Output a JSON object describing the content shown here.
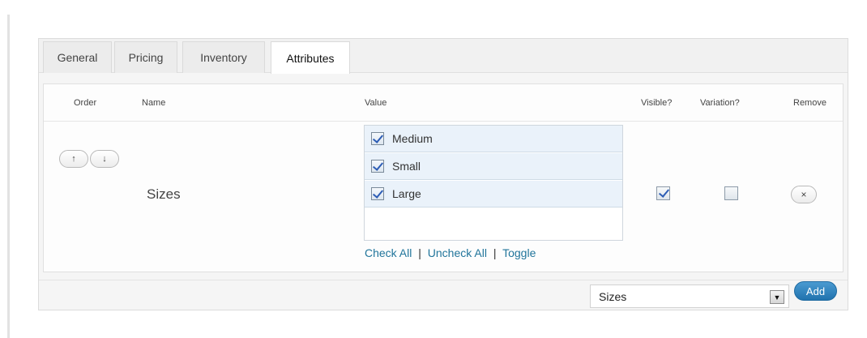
{
  "tabs": [
    {
      "label": "General"
    },
    {
      "label": "Pricing"
    },
    {
      "label": "Inventory"
    },
    {
      "label": "Attributes",
      "active": true
    }
  ],
  "table": {
    "headers": {
      "order": "Order",
      "name": "Name",
      "value": "Value",
      "visible": "Visible?",
      "variation": "Variation?",
      "remove": "Remove"
    },
    "row": {
      "order_up": "↑",
      "order_down": "↓",
      "name": "Sizes",
      "values": [
        {
          "label": "Medium",
          "checked": true
        },
        {
          "label": "Small",
          "checked": true
        },
        {
          "label": "Large",
          "checked": true
        }
      ],
      "links": {
        "check_all": "Check All",
        "uncheck_all": "Uncheck All",
        "toggle": "Toggle",
        "separator": "|"
      },
      "visible": true,
      "variation": false,
      "remove_label": "×"
    }
  },
  "footer": {
    "select_value": "Sizes",
    "select_arrow": "▼",
    "add_label": "Add"
  },
  "colors": {
    "link": "#21759b",
    "add_button": "#2a7fc0",
    "value_item_bg": "#eaf2fa"
  }
}
